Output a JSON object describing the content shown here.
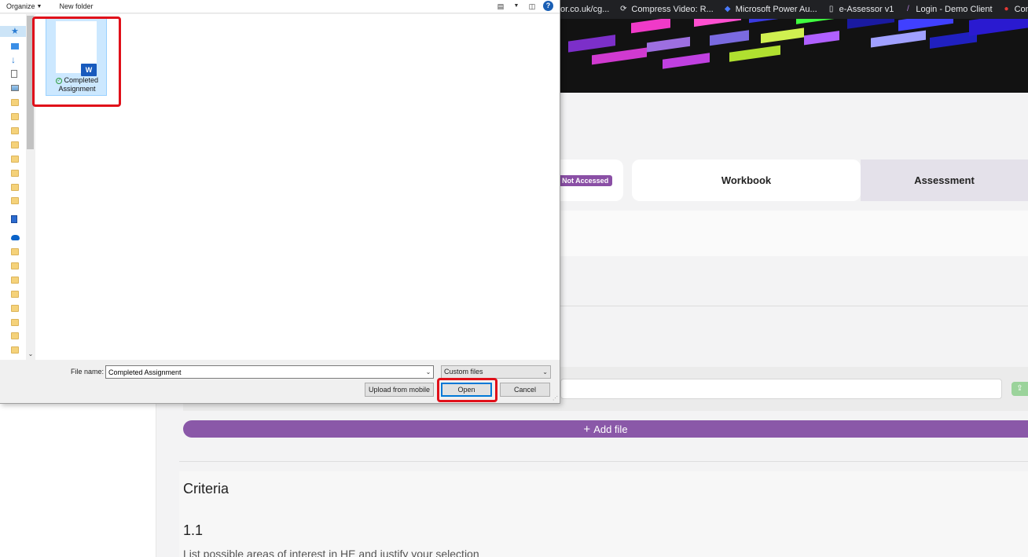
{
  "bookmarks": [
    {
      "label": "or.co.uk/cg...",
      "icon": "link-icon"
    },
    {
      "label": "Compress Video: R...",
      "icon": "refresh-icon"
    },
    {
      "label": "Microsoft Power Au...",
      "icon": "power-automate-icon"
    },
    {
      "label": "e-Assessor v1",
      "icon": "page-icon"
    },
    {
      "label": "Login - Demo Client",
      "icon": "slash-icon"
    },
    {
      "label": "Convertio — File C...",
      "icon": "convertio-icon"
    }
  ],
  "page": {
    "status_badge": "Not Accessed",
    "tab_workbook": "Workbook",
    "tab_assessment": "Assessment",
    "add_file": "Add file",
    "criteria_title": "Criteria",
    "criterion_number": "1.1",
    "criterion_text": "List possible areas of interest in HE and justify your selection",
    "accent_color": "#8a58a8"
  },
  "dialog": {
    "toolbar": {
      "organize": "Organize",
      "new_folder": "New folder",
      "help": "?"
    },
    "files": [
      {
        "name": "Completed Assignment",
        "type": "word-document"
      }
    ],
    "file_name_label": "File name:",
    "file_name_value": "Completed Assignment",
    "filter_value": "Custom files",
    "upload_button": "Upload from mobile",
    "open_button": "Open",
    "cancel_button": "Cancel"
  }
}
